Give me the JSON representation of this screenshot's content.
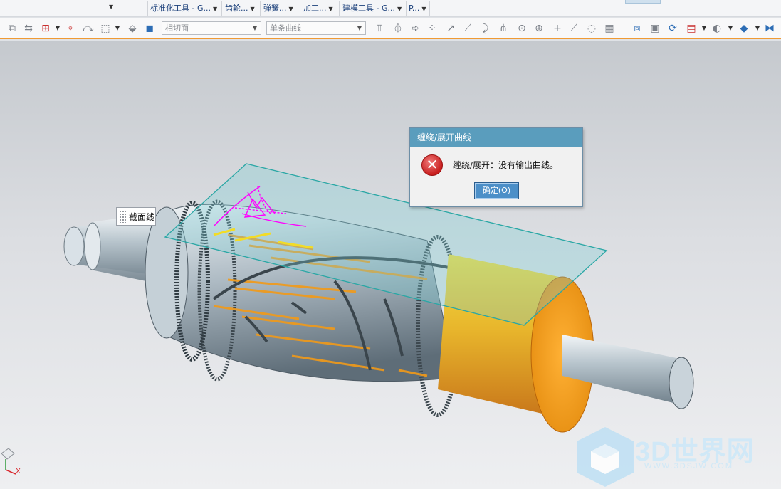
{
  "ribbon": {
    "menus": [
      {
        "label": "标准化工具 - G..."
      },
      {
        "label": "齿轮..."
      },
      {
        "label": "弹簧..."
      },
      {
        "label": "加工..."
      },
      {
        "label": "建模工具 - G..."
      },
      {
        "label": "P..."
      }
    ]
  },
  "toolbar": {
    "face_rule": {
      "value": "相切面"
    },
    "curve_rule": {
      "value": "单条曲线"
    }
  },
  "viewport": {
    "section_tag": "截面线",
    "triad_x_label": "X"
  },
  "dialog": {
    "title": "缠绕/展开曲线",
    "message": "缠绕/展开：没有输出曲线。",
    "ok_label": "确定(O)",
    "icon": "error-icon"
  },
  "watermark": {
    "brand": "3D世界网",
    "url": "WWW.3DSJW.COM"
  },
  "colors": {
    "accent_orange": "#f09a33",
    "dialog_title": "#5a9dbd",
    "highlight_magenta": "#ff00ff",
    "plane_teal": "#2aa7a5",
    "sleeve_orange": "#f0a020"
  }
}
